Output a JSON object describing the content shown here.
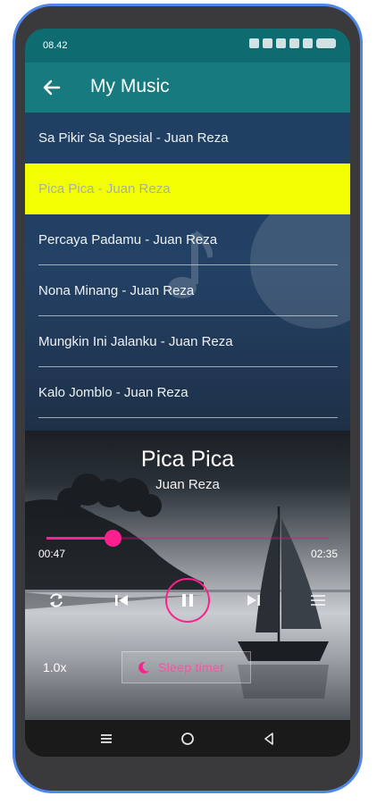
{
  "status_bar": {
    "time": "08.42"
  },
  "app_bar": {
    "title": "My Music"
  },
  "songs": [
    {
      "title": "Sa Pikir Sa Spesial - Juan Reza"
    },
    {
      "title": "Pica Pica - Juan Reza"
    },
    {
      "title": "Percaya Padamu - Juan Reza"
    },
    {
      "title": "Nona Minang - Juan Reza"
    },
    {
      "title": "Mungkin Ini Jalanku - Juan Reza"
    },
    {
      "title": "Kalo Jomblo - Juan Reza"
    }
  ],
  "player": {
    "title": "Pica Pica",
    "artist": "Juan Reza",
    "elapsed": "00:47",
    "duration": "02:35",
    "progress": 0.235,
    "speed": "1.0x",
    "sleep_timer_label": "Sleep timer"
  },
  "colors": {
    "accent": "#ff1f8e",
    "highlight": "#f1ff00",
    "app_bar": "#167a7f",
    "status_bar": "#0e6b6f"
  },
  "icons": {
    "back": "arrow-left-icon",
    "repeat": "repeat-icon",
    "previous": "skip-previous-icon",
    "play_pause": "pause-icon",
    "next": "skip-next-icon",
    "playlist": "playlist-icon",
    "sleep": "moon-icon"
  }
}
